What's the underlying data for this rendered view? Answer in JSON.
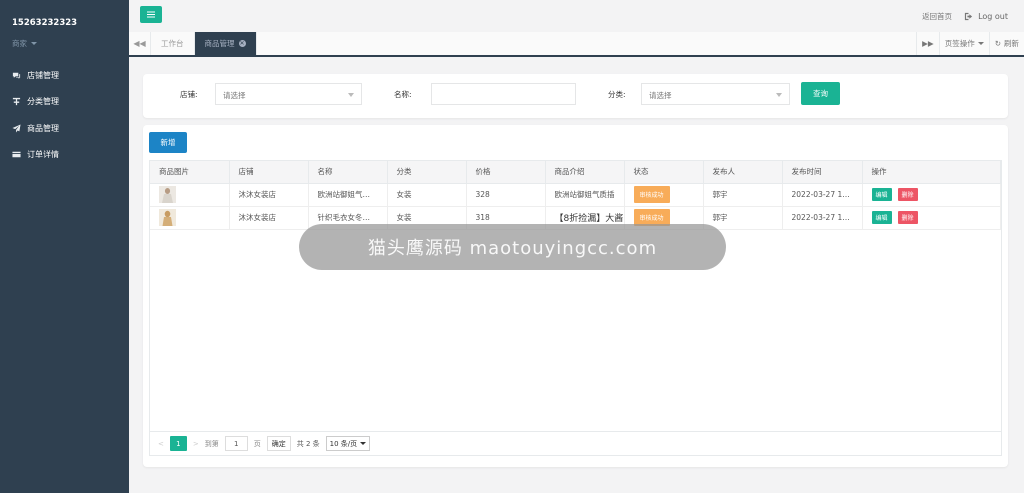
{
  "sidebar": {
    "username": "15263232323",
    "role": "商家",
    "items": [
      {
        "label": "店铺管理",
        "icon": "comments-icon"
      },
      {
        "label": "分类管理",
        "icon": "sitemap-icon"
      },
      {
        "label": "商品管理",
        "icon": "paper-plane-icon"
      },
      {
        "label": "订单详情",
        "icon": "credit-card-icon"
      }
    ]
  },
  "topbar": {
    "home_link": "返回首页",
    "logout": "Log out"
  },
  "tabs": {
    "items": [
      "工作台",
      "商品管理"
    ],
    "page_ops": "页签操作",
    "refresh": "刷新"
  },
  "search": {
    "shop_label": "店铺:",
    "shop_placeholder": "请选择",
    "name_label": "名称:",
    "name_value": "",
    "category_label": "分类:",
    "category_placeholder": "请选择",
    "query_button": "查询"
  },
  "table": {
    "add_button": "新增",
    "columns": [
      "商品图片",
      "店铺",
      "名称",
      "分类",
      "价格",
      "商品介绍",
      "状态",
      "发布人",
      "发布时间",
      "操作"
    ],
    "rows": [
      {
        "shop": "沐沐女装店",
        "name": "欧洲站御姐气…",
        "category": "女装",
        "price": "328",
        "intro": "欧洲站御姐气质插",
        "status": "审核成功",
        "publisher": "郭宇",
        "time": "2022-03-27 1…",
        "edit": "编辑",
        "delete": "删除"
      },
      {
        "shop": "沐沐女装店",
        "name": "针织毛衣女冬…",
        "category": "女装",
        "price": "318",
        "intro": "【8折捡漏】大酱",
        "status": "审核成功",
        "publisher": "郭宇",
        "time": "2022-03-27 1…",
        "edit": "编辑",
        "delete": "删除"
      }
    ]
  },
  "pager": {
    "current": "1",
    "goto_label": "到第",
    "goto_value": "1",
    "page_unit": "页",
    "confirm": "确定",
    "total": "共 2 条",
    "page_size": "10 条/页"
  },
  "overlay_text": "猫头鹰源码 maotouyingcc.com",
  "colors": {
    "sidebar_bg": "#2f4050",
    "primary": "#1ab394",
    "add_button": "#1c84c6",
    "status_badge": "#f8ac59",
    "delete_button": "#ed5565"
  }
}
